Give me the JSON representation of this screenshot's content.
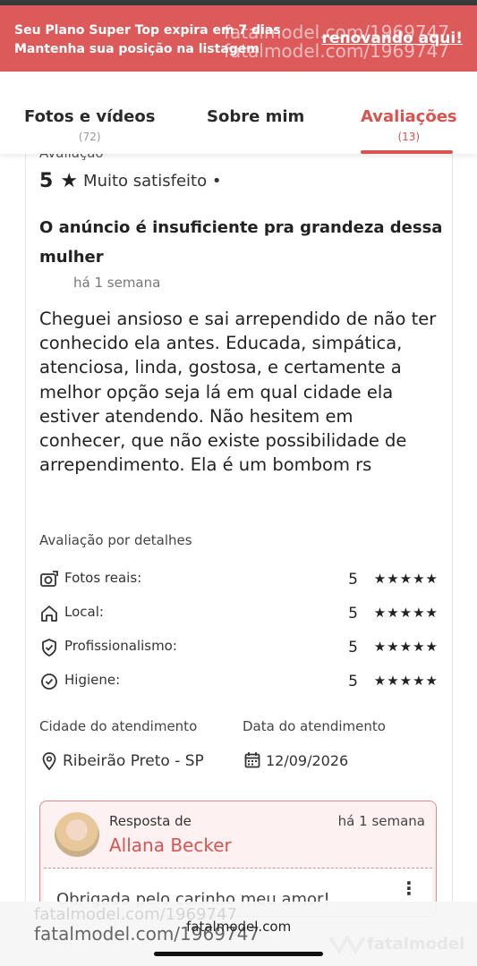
{
  "banner": {
    "line1": "Seu Plano Super Top expira em 7 dias",
    "line2": "Mantenha sua posição na listagem",
    "link": "renovando aqui!"
  },
  "tabs": [
    {
      "label": "Fotos e vídeos",
      "count": "(72)"
    },
    {
      "label": "Sobre mim",
      "count": ""
    },
    {
      "label": "Avaliações",
      "count": "(13)"
    }
  ],
  "review": {
    "section_label": "Avaliação",
    "score": "5",
    "star": "★",
    "satisfaction": "Muito satisfeito •",
    "title": "O anúncio é insuficiente pra grandeza dessa mulher",
    "time": "há 1 semana",
    "body": "Cheguei ansioso e sai arrependido de não ter conhecido ela antes. Educada, simpática, atenciosa, linda, gostosa, e certamente a melhor opção seja lá em qual cidade ela estiver atendendo. Não hesitem em conhecer, que não existe possibilidade de arrependimento. Ela é um bombom rs"
  },
  "details": {
    "title": "Avaliação por detalhes",
    "items": [
      {
        "label": "Fotos reais:",
        "score": "5",
        "stars": "★★★★★",
        "icon": "camera-icon"
      },
      {
        "label": "Local:",
        "score": "5",
        "stars": "★★★★★",
        "icon": "home-icon"
      },
      {
        "label": "Profissionalismo:",
        "score": "5",
        "stars": "★★★★★",
        "icon": "shield-check-icon"
      },
      {
        "label": "Higiene:",
        "score": "5",
        "stars": "★★★★★",
        "icon": "check-circle-icon"
      }
    ]
  },
  "service": {
    "city_label": "Cidade do atendimento",
    "city": "Ribeirão Preto - SP",
    "date_label": "Data do atendimento",
    "date": "12/09/2026"
  },
  "reply": {
    "label": "Resposta de",
    "name": "Allana Becker",
    "time": "há 1 semana",
    "message": "Obrigada pelo carinho meu amor!",
    "more": "⋮"
  },
  "watermark": {
    "banner_a": "fatalmodel.com/1969747",
    "banner_b": "fatalmodel.com/1969747",
    "bottom_faint": "fatalmodel.com/1969747",
    "bottom": "fatalmodel.com/1969747",
    "bottom_site": "fatalmodel.com",
    "logo": "fatalmodel"
  }
}
